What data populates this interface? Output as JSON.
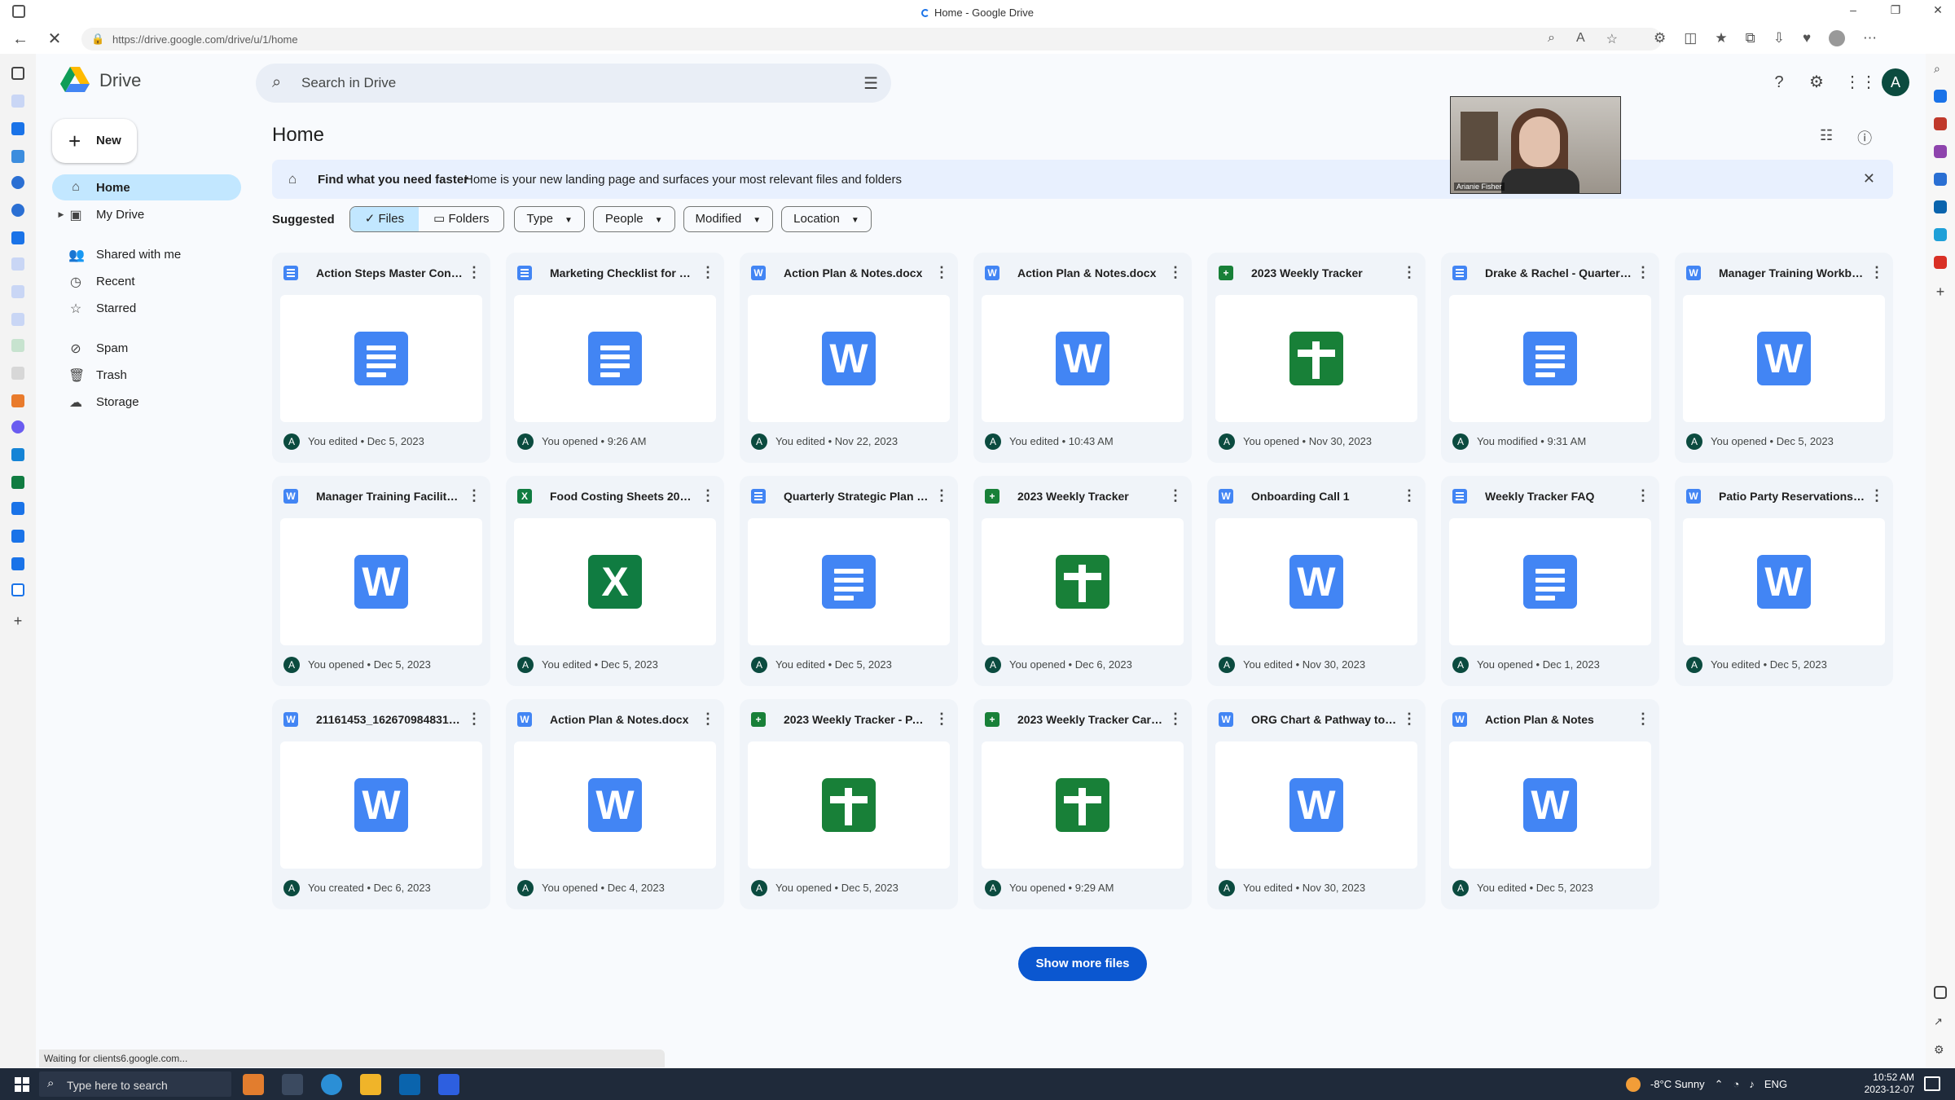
{
  "browser": {
    "window_title": "Home - Google Drive",
    "url": "https://drive.google.com/drive/u/1/home"
  },
  "app": {
    "brand": "Drive",
    "search_placeholder": "Search in Drive",
    "new_label": "New",
    "avatar_initial": "A"
  },
  "nav": {
    "home": "Home",
    "my_drive": "My Drive",
    "shared": "Shared with me",
    "recent": "Recent",
    "starred": "Starred",
    "spam": "Spam",
    "trash": "Trash",
    "storage": "Storage"
  },
  "main": {
    "page_title": "Home",
    "banner_title": "Find what you need faster",
    "banner_text": "Home is your new landing page and surfaces your most relevant files and folders",
    "suggested_label": "Suggested",
    "seg_files": "Files",
    "seg_folders": "Folders",
    "filters": [
      "Type",
      "People",
      "Modified",
      "Location"
    ],
    "show_more": "Show more files"
  },
  "files": [
    {
      "title": "Action Steps Master Conte...",
      "type": "doc",
      "meta": "You edited • Dec 5, 2023"
    },
    {
      "title": "Marketing Checklist for 1% ...",
      "type": "doc",
      "meta": "You opened • 9:26 AM"
    },
    {
      "title": "Action Plan & Notes.docx",
      "type": "word",
      "meta": "You edited • Nov 22, 2023"
    },
    {
      "title": "Action Plan & Notes.docx",
      "type": "word",
      "meta": "You edited • 10:43 AM"
    },
    {
      "title": "2023 Weekly Tracker",
      "type": "sheet",
      "meta": "You opened • Nov 30, 2023"
    },
    {
      "title": "Drake & Rachel - Quarterly ...",
      "type": "doc",
      "meta": "You modified • 9:31 AM"
    },
    {
      "title": "Manager Training Workboo...",
      "type": "word",
      "meta": "You opened • Dec 5, 2023"
    },
    {
      "title": "Manager Training Facilitato...",
      "type": "word",
      "meta": "You opened • Dec 5, 2023"
    },
    {
      "title": "Food Costing Sheets 2023 ...",
      "type": "excel",
      "meta": "You edited • Dec 5, 2023"
    },
    {
      "title": "Quarterly Strategic Plan (Q...",
      "type": "doc",
      "meta": "You edited • Dec 5, 2023"
    },
    {
      "title": "2023 Weekly Tracker",
      "type": "sheet",
      "meta": "You opened • Dec 6, 2023"
    },
    {
      "title": "Onboarding Call 1",
      "type": "word",
      "meta": "You edited • Nov 30, 2023"
    },
    {
      "title": "Weekly Tracker FAQ",
      "type": "doc",
      "meta": "You opened • Dec 1, 2023"
    },
    {
      "title": "Patio Party Reservations.d...",
      "type": "word",
      "meta": "You edited • Dec 5, 2023"
    },
    {
      "title": "21161453_1626709848319Re...",
      "type": "word",
      "meta": "You created • Dec 6, 2023"
    },
    {
      "title": "Action Plan & Notes.docx",
      "type": "word",
      "meta": "You opened • Dec 4, 2023"
    },
    {
      "title": "2023 Weekly Tracker - PARIS",
      "type": "sheet",
      "meta": "You opened • Dec 5, 2023"
    },
    {
      "title": "2023 Weekly Tracker Caren...",
      "type": "sheet",
      "meta": "You opened • 9:29 AM"
    },
    {
      "title": "ORG Chart & Pathway to Pr...",
      "type": "word",
      "meta": "You edited • Nov 30, 2023"
    },
    {
      "title": "Action Plan & Notes",
      "type": "word",
      "meta": "You edited • Dec 5, 2023"
    }
  ],
  "video": {
    "name": "Arianie Fisher"
  },
  "status_bar": "Waiting for clients6.google.com...",
  "taskbar": {
    "search_placeholder": "Type here to search",
    "weather": "-8°C  Sunny",
    "lang": "ENG",
    "time": "10:52 AM",
    "date": "2023-12-07"
  },
  "colors": {
    "accent": "#0b57d0",
    "nav_active": "#c2e7ff",
    "banner": "#e8f0fe",
    "doc": "#4285f4",
    "sheet": "#188038",
    "excel": "#107c41"
  }
}
